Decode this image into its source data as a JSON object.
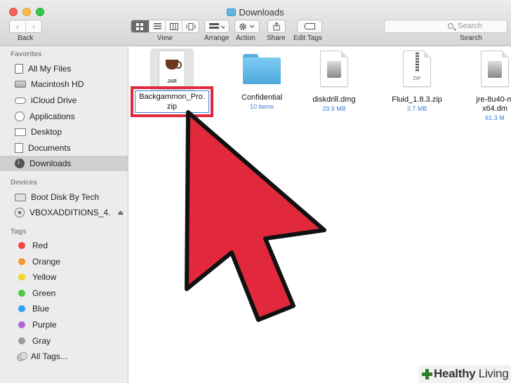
{
  "window": {
    "title": "Downloads"
  },
  "toolbar": {
    "nav_back": "‹",
    "nav_forward": "›",
    "back_label": "Back",
    "view_label": "View",
    "arrange_label": "Arrange",
    "action_label": "Action",
    "share_label": "Share",
    "edit_tags_label": "Edit Tags",
    "search_placeholder": "Search",
    "search_label": "Search"
  },
  "sidebar": {
    "favorites_title": "Favorites",
    "favorites": [
      {
        "label": "All My Files",
        "icon": "all-files-icon"
      },
      {
        "label": "Macintosh HD",
        "icon": "hard-drive-icon"
      },
      {
        "label": "iCloud Drive",
        "icon": "cloud-icon"
      },
      {
        "label": "Applications",
        "icon": "applications-icon"
      },
      {
        "label": "Desktop",
        "icon": "desktop-icon"
      },
      {
        "label": "Documents",
        "icon": "documents-icon"
      },
      {
        "label": "Downloads",
        "icon": "downloads-icon",
        "selected": true
      }
    ],
    "devices_title": "Devices",
    "devices": [
      {
        "label": "Boot Disk By Tech",
        "icon": "disk-icon"
      },
      {
        "label": "VBOXADDITIONS_4.",
        "icon": "optical-disc-icon"
      }
    ],
    "tags_title": "Tags",
    "tags": [
      {
        "label": "Red",
        "color": "#f2473f"
      },
      {
        "label": "Orange",
        "color": "#f7962f"
      },
      {
        "label": "Yellow",
        "color": "#f5d327"
      },
      {
        "label": "Green",
        "color": "#4bcc3c"
      },
      {
        "label": "Blue",
        "color": "#2ea3f2"
      },
      {
        "label": "Purple",
        "color": "#b464dc"
      },
      {
        "label": "Gray",
        "color": "#9a9a9a"
      },
      {
        "label": "All Tags...",
        "icon": "all-tags-icon"
      }
    ]
  },
  "files": [
    {
      "name_line1": "Backgammon_Pro.",
      "name_line2": "zip",
      "icon": "jar-file-icon",
      "icon_text": "JAR",
      "editing": true
    },
    {
      "name": "Confidential",
      "meta": "10 items",
      "icon": "folder-icon"
    },
    {
      "name": "diskdrill.dmg",
      "meta": "29.9 MB",
      "icon": "disk-image-icon"
    },
    {
      "name": "Fluid_1.8.3.zip",
      "meta": "3.7 MB",
      "icon": "zip-file-icon",
      "icon_text": "ZIP"
    },
    {
      "name_line1": "jre-8u40-m",
      "name_line2": "x64.dm",
      "meta": "61.3 M",
      "icon": "disk-image-icon"
    }
  ],
  "overlay": {
    "arrow_color": "#e2293b",
    "highlight_color": "#e2293b"
  },
  "watermark": {
    "brand_bold": "Healthy",
    "brand_light": " Living"
  }
}
